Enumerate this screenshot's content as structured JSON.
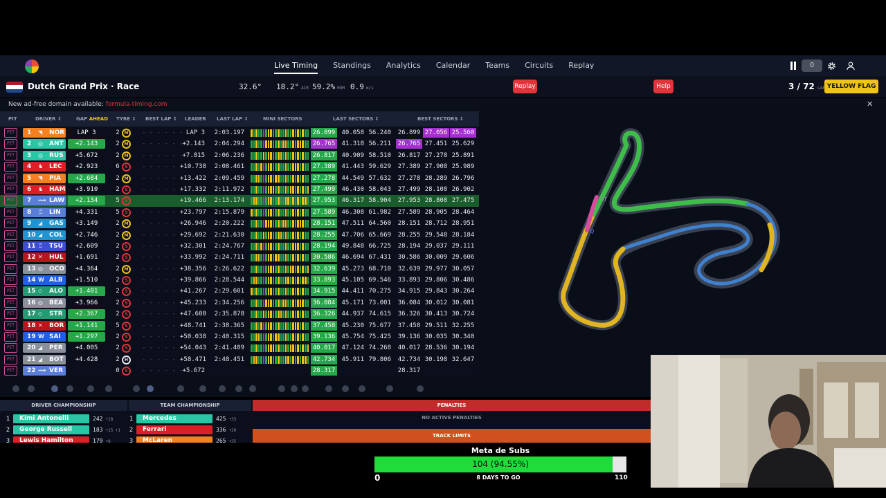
{
  "nav": {
    "links": [
      "Live Timing",
      "Standings",
      "Analytics",
      "Calendar",
      "Teams",
      "Circuits",
      "Replay"
    ],
    "active": "Live Timing",
    "delay_value": "0"
  },
  "session": {
    "title": "Dutch Grand Prix · Race",
    "flag_colors": [
      "#ae1c28",
      "#ffffff",
      "#21468b"
    ],
    "track_temp": "32.6°",
    "air_temp": "18.2°",
    "air_label": "AIR",
    "humidity": "59.2%",
    "hum_label": "HUM",
    "wind": "0.9",
    "wind_label": "m/s",
    "replay_button": "Replay",
    "help_button": "Help",
    "lap": "3 / 72",
    "lap_label": "LAP",
    "flag_status": "YELLOW FLAG"
  },
  "notice": {
    "text": "New ad-free domain available:",
    "link": "formula-timing.com",
    "close": "✕"
  },
  "table": {
    "headers": {
      "pit": "PIT",
      "driver": "DRIVER ↕",
      "gap": "GAP",
      "gap_mode": "AHEAD",
      "tyre": "TYRE ↕",
      "best_lap": "BEST LAP ↕",
      "leader": "LEADER",
      "last_lap": "LAST LAP ↕",
      "mini": "MINI SECTORS",
      "last_sectors": "LAST SECTORS ↕",
      "best_sectors": "BEST SECTORS ↕"
    },
    "rows": [
      {
        "pit": "PIT",
        "pos": "1",
        "icon": "◥",
        "code": "NOR",
        "color": "#f58020",
        "gap": "LAP 3",
        "gap_green": false,
        "laps": "2",
        "tyre": "M",
        "best": "- - -  - - -",
        "leader": "LAP 3",
        "last": "2:03.197",
        "ls1": "26.899",
        "ls1c": "g",
        "ls2": "40.058",
        "ls3": "56.240",
        "bs1": "26.899",
        "bs1c": "",
        "bs2": "27.056",
        "bs2c": "p",
        "bs3": "25.560",
        "bs3c": "p"
      },
      {
        "pit": "PIT",
        "pos": "2",
        "icon": "◎",
        "code": "ANT",
        "color": "#27c6a4",
        "gap": "+2.143",
        "gap_green": true,
        "laps": "2",
        "tyre": "M",
        "best": "- - -  - - -",
        "leader": "+2.143",
        "last": "2:04.294",
        "ls1": "26.765",
        "ls1c": "p",
        "ls2": "41.318",
        "ls3": "56.211",
        "bs1": "26.765",
        "bs1c": "p",
        "bs2": "27.451",
        "bs2c": "",
        "bs3": "25.629",
        "bs3c": ""
      },
      {
        "pit": "PIT",
        "pos": "3",
        "icon": "◎",
        "code": "RUS",
        "color": "#27c6a4",
        "gap": "+5.672",
        "gap_green": false,
        "laps": "2",
        "tyre": "M",
        "best": "- - -  - - -",
        "leader": "+7.815",
        "last": "2:06.236",
        "ls1": "26.817",
        "ls1c": "g",
        "ls2": "40.909",
        "ls3": "58.510",
        "bs1": "26.817",
        "bs1c": "",
        "bs2": "27.278",
        "bs2c": "",
        "bs3": "25.891",
        "bs3c": ""
      },
      {
        "pit": "PIT",
        "pos": "4",
        "icon": "♞",
        "code": "LEC",
        "color": "#dc1f26",
        "gap": "+2.923",
        "gap_green": false,
        "laps": "6",
        "tyre": "S",
        "best": "- - -  - - -",
        "leader": "+10.738",
        "last": "2:08.461",
        "ls1": "27.389",
        "ls1c": "g",
        "ls2": "41.443",
        "ls3": "59.629",
        "bs1": "27.389",
        "bs1c": "",
        "bs2": "27.908",
        "bs2c": "",
        "bs3": "25.989",
        "bs3c": ""
      },
      {
        "pit": "PIT",
        "pos": "5",
        "icon": "◥",
        "code": "PIA",
        "color": "#f58020",
        "gap": "+2.684",
        "gap_green": true,
        "laps": "2",
        "tyre": "M",
        "best": "- - -  - - -",
        "leader": "+13.422",
        "last": "2:09.459",
        "ls1": "27.278",
        "ls1c": "g",
        "ls2": "44.549",
        "ls3": "57.632",
        "bs1": "27.278",
        "bs1c": "",
        "bs2": "28.289",
        "bs2c": "",
        "bs3": "26.796",
        "bs3c": ""
      },
      {
        "pit": "PIT",
        "pos": "6",
        "icon": "♞",
        "code": "HAM",
        "color": "#dc1f26",
        "gap": "+3.910",
        "gap_green": false,
        "laps": "2",
        "tyre": "S",
        "best": "- - -  - - -",
        "leader": "+17.332",
        "last": "2:11.972",
        "ls1": "27.499",
        "ls1c": "g",
        "ls2": "46.430",
        "ls3": "58.043",
        "bs1": "27.499",
        "bs1c": "",
        "bs2": "28.108",
        "bs2c": "",
        "bs3": "26.902",
        "bs3c": ""
      },
      {
        "pit": "PIT",
        "pos": "7",
        "icon": "⟿",
        "code": "LAW",
        "color": "#5b7fd9",
        "gap": "+2.134",
        "gap_green": true,
        "laps": "5",
        "tyre": "S",
        "best": "- - -  - - -",
        "leader": "+19.466",
        "last": "2:13.174",
        "ls1": "27.953",
        "ls1c": "g",
        "ls2": "46.317",
        "ls3": "58.904",
        "bs1": "27.953",
        "bs1c": "",
        "bs2": "28.808",
        "bs2c": "",
        "bs3": "27.475",
        "bs3c": "",
        "highlight": true
      },
      {
        "pit": "PIT",
        "pos": "8",
        "icon": "♖",
        "code": "LIN",
        "color": "#5b7fd9",
        "gap": "+4.331",
        "gap_green": false,
        "laps": "5",
        "tyre": "S",
        "best": "- - -  - - -",
        "leader": "+23.797",
        "last": "2:15.879",
        "ls1": "27.589",
        "ls1c": "g",
        "ls2": "46.308",
        "ls3": "61.982",
        "bs1": "27.589",
        "bs1c": "",
        "bs2": "28.905",
        "bs2c": "",
        "bs3": "28.464",
        "bs3c": ""
      },
      {
        "pit": "PIT",
        "pos": "9",
        "icon": "◢",
        "code": "GAS",
        "color": "#2293d1",
        "gap": "+3.149",
        "gap_green": false,
        "laps": "2",
        "tyre": "M",
        "best": "- - -  - - -",
        "leader": "+26.946",
        "last": "2:20.222",
        "ls1": "28.151",
        "ls1c": "g",
        "ls2": "47.511",
        "ls3": "64.560",
        "bs1": "28.151",
        "bs1c": "",
        "bs2": "28.712",
        "bs2c": "",
        "bs3": "28.951",
        "bs3c": ""
      },
      {
        "pit": "PIT",
        "pos": "10",
        "icon": "◢",
        "code": "COL",
        "color": "#2293d1",
        "gap": "+2.746",
        "gap_green": false,
        "laps": "2",
        "tyre": "M",
        "best": "- - -  - - -",
        "leader": "+29.692",
        "last": "2:21.630",
        "ls1": "28.255",
        "ls1c": "g",
        "ls2": "47.706",
        "ls3": "65.669",
        "bs1": "28.255",
        "bs1c": "",
        "bs2": "29.548",
        "bs2c": "",
        "bs3": "28.184",
        "bs3c": ""
      },
      {
        "pit": "PIT",
        "pos": "11",
        "icon": "♖",
        "code": "TSU",
        "color": "#3d4fd0",
        "gap": "+2.609",
        "gap_green": false,
        "laps": "2",
        "tyre": "S",
        "best": "- - -  - - -",
        "leader": "+32.301",
        "last": "2:24.767",
        "ls1": "28.194",
        "ls1c": "g",
        "ls2": "49.848",
        "ls3": "66.725",
        "bs1": "28.194",
        "bs1c": "",
        "bs2": "29.037",
        "bs2c": "",
        "bs3": "29.111",
        "bs3c": ""
      },
      {
        "pit": "PIT",
        "pos": "12",
        "icon": "✕",
        "code": "HUL",
        "color": "#b9151b",
        "gap": "+1.691",
        "gap_green": false,
        "laps": "2",
        "tyre": "S",
        "best": "- - -  - - -",
        "leader": "+33.992",
        "last": "2:24.711",
        "ls1": "30.586",
        "ls1c": "g",
        "ls2": "46.694",
        "ls3": "67.431",
        "bs1": "30.586",
        "bs1c": "",
        "bs2": "30.009",
        "bs2c": "",
        "bs3": "29.606",
        "bs3c": ""
      },
      {
        "pit": "PIT",
        "pos": "13",
        "icon": "◎",
        "code": "OCO",
        "color": "#8a8f9c",
        "gap": "+4.364",
        "gap_green": false,
        "laps": "2",
        "tyre": "M",
        "best": "- - -  - - -",
        "leader": "+38.356",
        "last": "2:26.622",
        "ls1": "32.639",
        "ls1c": "g",
        "ls2": "45.273",
        "ls3": "68.710",
        "bs1": "32.639",
        "bs1c": "",
        "bs2": "29.977",
        "bs2c": "",
        "bs3": "30.057",
        "bs3c": ""
      },
      {
        "pit": "PIT",
        "pos": "14",
        "icon": "W",
        "code": "ALB",
        "color": "#1f5fe0",
        "gap": "+1.510",
        "gap_green": false,
        "laps": "2",
        "tyre": "S",
        "best": "- - -  - - -",
        "leader": "+39.866",
        "last": "2:28.544",
        "ls1": "33.893",
        "ls1c": "g",
        "ls2": "45.105",
        "ls3": "69.546",
        "bs1": "33.893",
        "bs1c": "",
        "bs2": "29.806",
        "bs2c": "",
        "bs3": "30.486",
        "bs3c": ""
      },
      {
        "pit": "PIT",
        "pos": "15",
        "icon": "◇",
        "code": "ALO",
        "color": "#229b72",
        "gap": "+1.401",
        "gap_green": true,
        "laps": "2",
        "tyre": "S",
        "best": "- - -  - - -",
        "leader": "+41.267",
        "last": "2:29.601",
        "ls1": "34.915",
        "ls1c": "g",
        "ls2": "44.411",
        "ls3": "70.275",
        "bs1": "34.915",
        "bs1c": "",
        "bs2": "29.843",
        "bs2c": "",
        "bs3": "30.264",
        "bs3c": ""
      },
      {
        "pit": "PIT",
        "pos": "16",
        "icon": "◎",
        "code": "BEA",
        "color": "#8a8f9c",
        "gap": "+3.966",
        "gap_green": false,
        "laps": "2",
        "tyre": "S",
        "best": "- - -  - - -",
        "leader": "+45.233",
        "last": "2:34.256",
        "ls1": "36.084",
        "ls1c": "g",
        "ls2": "45.171",
        "ls3": "73.001",
        "bs1": "36.084",
        "bs1c": "",
        "bs2": "30.012",
        "bs2c": "",
        "bs3": "30.081",
        "bs3c": ""
      },
      {
        "pit": "PIT",
        "pos": "17",
        "icon": "◇",
        "code": "STR",
        "color": "#229b72",
        "gap": "+2.367",
        "gap_green": true,
        "laps": "2",
        "tyre": "S",
        "best": "- - -  - - -",
        "leader": "+47.600",
        "last": "2:35.878",
        "ls1": "36.326",
        "ls1c": "g",
        "ls2": "44.937",
        "ls3": "74.615",
        "bs1": "36.326",
        "bs1c": "",
        "bs2": "30.413",
        "bs2c": "",
        "bs3": "30.724",
        "bs3c": ""
      },
      {
        "pit": "PIT",
        "pos": "18",
        "icon": "✕",
        "code": "BOR",
        "color": "#b9151b",
        "gap": "+1.141",
        "gap_green": true,
        "laps": "5",
        "tyre": "S",
        "best": "- - -  - - -",
        "leader": "+48.741",
        "last": "2:38.365",
        "ls1": "37.458",
        "ls1c": "g",
        "ls2": "45.230",
        "ls3": "75.677",
        "bs1": "37.458",
        "bs1c": "",
        "bs2": "29.511",
        "bs2c": "",
        "bs3": "32.255",
        "bs3c": ""
      },
      {
        "pit": "PIT",
        "pos": "19",
        "icon": "W",
        "code": "SAI",
        "color": "#1f5fe0",
        "gap": "+1.297",
        "gap_green": true,
        "laps": "2",
        "tyre": "S",
        "best": "- - -  - - -",
        "leader": "+50.038",
        "last": "2:40.315",
        "ls1": "39.136",
        "ls1c": "g",
        "ls2": "45.754",
        "ls3": "75.425",
        "bs1": "39.136",
        "bs1c": "",
        "bs2": "30.035",
        "bs2c": "",
        "bs3": "30.340",
        "bs3c": ""
      },
      {
        "pit": "PIT",
        "pos": "20",
        "icon": "◢",
        "code": "PER",
        "color": "#8a8f9c",
        "gap": "+4.005",
        "gap_green": false,
        "laps": "2",
        "tyre": "S",
        "best": "- - -  - - -",
        "leader": "+54.043",
        "last": "2:41.409",
        "ls1": "40.017",
        "ls1c": "g",
        "ls2": "47.124",
        "ls3": "74.268",
        "bs1": "40.017",
        "bs1c": "",
        "bs2": "28.536",
        "bs2c": "",
        "bs3": "30.194",
        "bs3c": ""
      },
      {
        "pit": "PIT",
        "pos": "21",
        "icon": "◢",
        "code": "BOT",
        "color": "#8a8f9c",
        "gap": "+4.428",
        "gap_green": false,
        "laps": "2",
        "tyre": "H",
        "best": "- - -  - - -",
        "leader": "+58.471",
        "last": "2:48.451",
        "ls1": "42.734",
        "ls1c": "g",
        "ls2": "45.911",
        "ls3": "79.806",
        "bs1": "42.734",
        "bs1c": "",
        "bs2": "30.198",
        "bs2c": "",
        "bs3": "32.647",
        "bs3c": ""
      },
      {
        "pit": "PIT",
        "pos": "22",
        "icon": "⟿",
        "code": "VER",
        "color": "#5b7fd9",
        "gap": "",
        "gap_green": false,
        "laps": "0",
        "tyre": "S",
        "best": "- - -  - - -",
        "leader": "+5.672",
        "last": "",
        "ls1": "28.317",
        "ls1c": "g",
        "ls2": "",
        "ls3": "",
        "bs1": "28.317",
        "bs1c": "",
        "bs2": "",
        "bs2c": "",
        "bs3": "",
        "bs3c": ""
      }
    ]
  },
  "track_labels": {
    "pit_label": "PIT",
    "marker": "Q"
  },
  "bottom": {
    "driver_champ_title": "DRIVER CHAMPIONSHIP",
    "team_champ_title": "TEAM CHAMPIONSHIP",
    "drivers": [
      {
        "pos": "1",
        "name": "Kimi Antonelli",
        "pts": "242",
        "delta": "+18",
        "color": "#27c6a4"
      },
      {
        "pos": "2",
        "name": "George Russell",
        "pts": "183",
        "delta": "+15 +1",
        "color": "#27c6a4"
      },
      {
        "pos": "3",
        "name": "Lewis Hamilton",
        "pts": "179",
        "delta": "+8",
        "color": "#dc1f26"
      }
    ],
    "teams": [
      {
        "pos": "1",
        "name": "Mercedes",
        "pts": "425",
        "delta": "+33",
        "color": "#27c6a4"
      },
      {
        "pos": "2",
        "name": "Ferrari",
        "pts": "336",
        "delta": "+20",
        "color": "#dc1f26"
      },
      {
        "pos": "3",
        "name": "McLaren",
        "pts": "265",
        "delta": "+35",
        "color": "#f58020"
      }
    ],
    "penalties_title": "PENALTIES",
    "no_penalties": "NO ACTIVE PENALTIES",
    "track_limits_title": "TRACK LIMITS"
  },
  "subs": {
    "title": "Meta de Subs",
    "value_text": "104 (94.55%)",
    "progress": 0.9455,
    "min": "0",
    "max": "110",
    "days_left": "8 DAYS TO GO"
  }
}
